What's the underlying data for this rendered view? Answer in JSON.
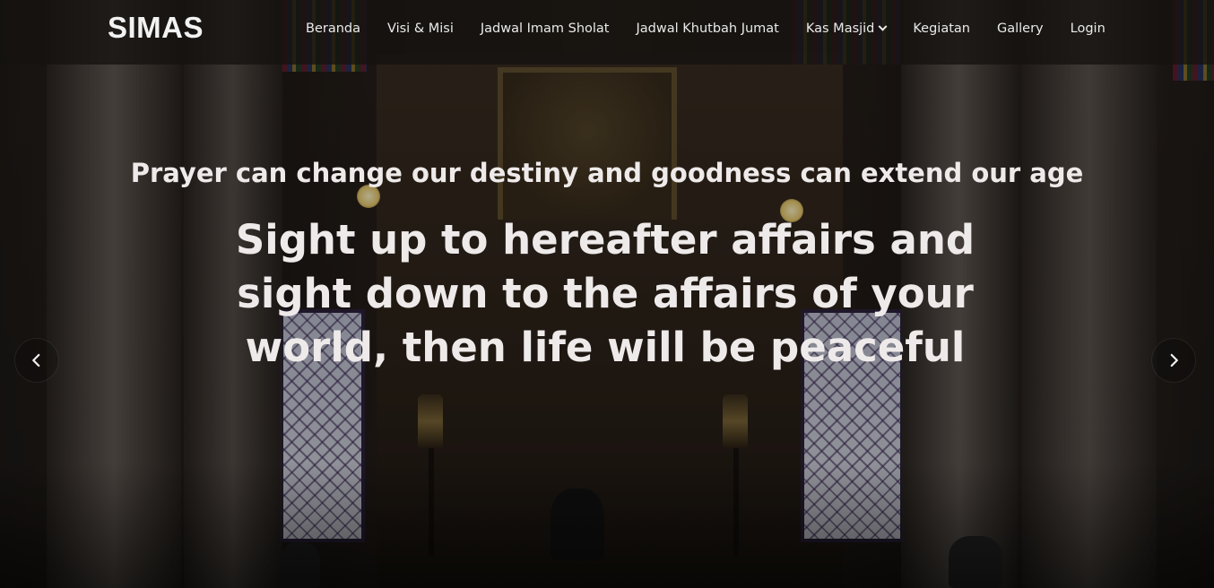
{
  "brand": "SIMAS",
  "nav": {
    "items": [
      {
        "label": "Beranda"
      },
      {
        "label": "Visi & Misi"
      },
      {
        "label": "Jadwal Imam Sholat"
      },
      {
        "label": "Jadwal Khutbah Jumat"
      },
      {
        "label": "Kas Masjid",
        "has_dropdown": true
      },
      {
        "label": "Kegiatan"
      },
      {
        "label": "Gallery"
      },
      {
        "label": "Login"
      }
    ]
  },
  "hero": {
    "subtitle": "Prayer can change our destiny and goodness can extend our age",
    "title": "Sight up to hereafter affairs and sight down to the affairs of your world, then life will be peaceful"
  },
  "carousel": {
    "prev_icon": "chevron-left-icon",
    "next_icon": "chevron-right-icon"
  },
  "colors": {
    "navbar_bg": "#141210",
    "text": "#eeeaea"
  }
}
